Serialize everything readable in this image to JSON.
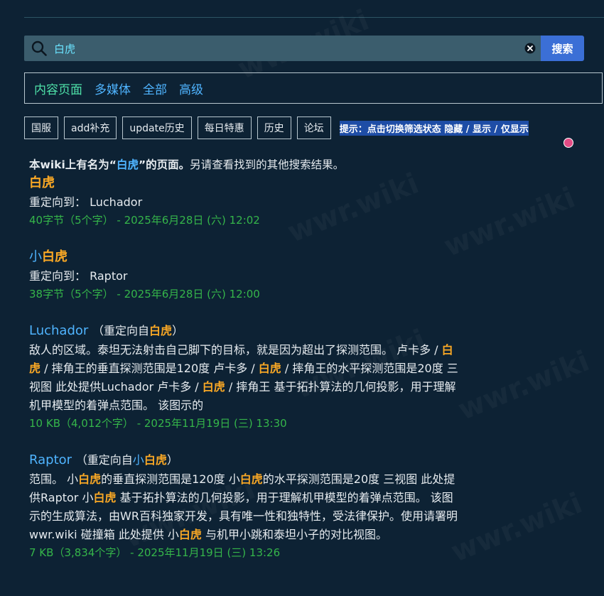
{
  "search": {
    "value": "白虎",
    "button_label": "搜索"
  },
  "filter_tabs": [
    {
      "label": "内容页面",
      "active": true
    },
    {
      "label": "多媒体",
      "active": false
    },
    {
      "label": "全部",
      "active": false
    },
    {
      "label": "高级",
      "active": false
    }
  ],
  "quick_buttons": [
    "国服",
    "add补充",
    "update历史",
    "每日特惠",
    "历史",
    "论坛"
  ],
  "hint": "提示：点击切换筛选状态 隐藏 / 显示 / 仅显示",
  "watermark": "wwr.wiki",
  "exact_match": {
    "prefix": "本wiki上有名为“",
    "term": "白虎",
    "suffix": "”的页面。",
    "extra": "另请查看找到的其他搜索结果。"
  },
  "results": [
    {
      "title_plain": "",
      "title_hl": "白虎",
      "redirect_label": "重定向到：",
      "redirect_target": "Luchador",
      "meta": "40字节（5个字） - 2025年6月28日 (六) 12:02"
    },
    {
      "title_plain": "小",
      "title_hl": "白虎",
      "redirect_label": "重定向到：",
      "redirect_target": "Raptor",
      "meta": "38字节（5个字） - 2025年6月28日 (六) 12:00"
    },
    {
      "title": "Luchador",
      "redirect_from_label": "（重定向自",
      "redirect_from_plain": "",
      "redirect_from_hl": "白虎",
      "redirect_from_close": "）",
      "snippet": [
        {
          "t": "敌人的区域。泰坦无法射击自己脚下的目标，就是因为超出了探测范围。 卢卡多 / "
        },
        {
          "t": "白虎",
          "hl": true
        },
        {
          "t": " / 摔角王的垂直探测范围是120度 卢卡多 / "
        },
        {
          "t": "白虎",
          "hl": true
        },
        {
          "t": " / 摔角王的水平探测范围是20度 三视图 此处提供Luchador 卢卡多 / "
        },
        {
          "t": "白虎",
          "hl": true
        },
        {
          "t": " / 摔角王 基于拓扑算法的几何投影，用于理解机甲模型的着弹点范围。 该图示的"
        }
      ],
      "meta": "10 KB（4,012个字） - 2025年11月19日 (三) 13:30"
    },
    {
      "title": "Raptor",
      "redirect_from_label": "（重定向自",
      "redirect_from_plain": "小",
      "redirect_from_hl": "白虎",
      "redirect_from_close": "）",
      "snippet": [
        {
          "t": "范围。 小"
        },
        {
          "t": "白虎",
          "hl": true
        },
        {
          "t": "的垂直探测范围是120度 小"
        },
        {
          "t": "白虎",
          "hl": true
        },
        {
          "t": "的水平探测范围是20度 三视图 此处提供Raptor 小"
        },
        {
          "t": "白虎",
          "hl": true
        },
        {
          "t": " 基于拓扑算法的几何投影，用于理解机甲模型的着弹点范围。 该图示的生成算法，由WR百科独家开发，具有唯一性和独特性，受法律保护。使用请署明 wwr.wiki 碰撞箱 此处提供 小"
        },
        {
          "t": "白虎",
          "hl": true
        },
        {
          "t": " 与机甲小跳和泰坦小子的对比视图。"
        }
      ],
      "meta": "7 KB（3,834个字） - 2025年11月19日 (三) 13:26"
    }
  ],
  "colors": {
    "background": "#0d2234",
    "link": "#4fb4ff",
    "highlight": "#f9a825",
    "meta": "#35b54a",
    "active_tab": "#4ee0a8",
    "search_button": "#3b6fd6"
  },
  "icons": [
    "search-icon",
    "clear-icon"
  ]
}
